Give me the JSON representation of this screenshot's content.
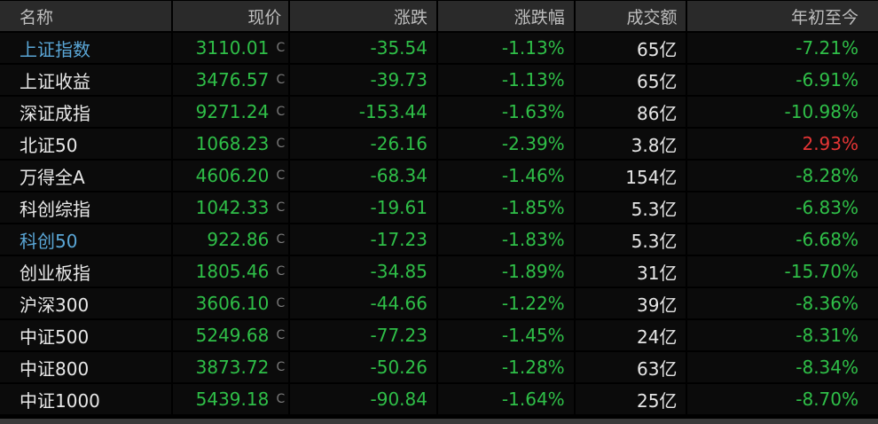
{
  "header": {
    "name": "名称",
    "price": "现价",
    "change": "涨跌",
    "change_pct": "涨跌幅",
    "volume": "成交额",
    "ytd": "年初至今"
  },
  "rows": [
    {
      "name": "上证指数",
      "link": true,
      "price": "3110.01",
      "mark": "C",
      "change": "-35.54",
      "change_pct": "-1.13%",
      "volume": "65亿",
      "ytd": "-7.21%",
      "ytd_dir": "neg"
    },
    {
      "name": "上证收益",
      "link": false,
      "price": "3476.57",
      "mark": "C",
      "change": "-39.73",
      "change_pct": "-1.13%",
      "volume": "65亿",
      "ytd": "-6.91%",
      "ytd_dir": "neg"
    },
    {
      "name": "深证成指",
      "link": false,
      "price": "9271.24",
      "mark": "C",
      "change": "-153.44",
      "change_pct": "-1.63%",
      "volume": "86亿",
      "ytd": "-10.98%",
      "ytd_dir": "neg"
    },
    {
      "name": "北证50",
      "link": false,
      "price": "1068.23",
      "mark": "C",
      "change": "-26.16",
      "change_pct": "-2.39%",
      "volume": "3.8亿",
      "ytd": "2.93%",
      "ytd_dir": "pos"
    },
    {
      "name": "万得全A",
      "link": false,
      "price": "4606.20",
      "mark": "C",
      "change": "-68.34",
      "change_pct": "-1.46%",
      "volume": "154亿",
      "ytd": "-8.28%",
      "ytd_dir": "neg"
    },
    {
      "name": "科创综指",
      "link": false,
      "price": "1042.33",
      "mark": "C",
      "change": "-19.61",
      "change_pct": "-1.85%",
      "volume": "5.3亿",
      "ytd": "-6.83%",
      "ytd_dir": "neg"
    },
    {
      "name": "科创50",
      "link": true,
      "price": "922.86",
      "mark": "C",
      "change": "-17.23",
      "change_pct": "-1.83%",
      "volume": "5.3亿",
      "ytd": "-6.68%",
      "ytd_dir": "neg"
    },
    {
      "name": "创业板指",
      "link": false,
      "price": "1805.46",
      "mark": "C",
      "change": "-34.85",
      "change_pct": "-1.89%",
      "volume": "31亿",
      "ytd": "-15.70%",
      "ytd_dir": "neg"
    },
    {
      "name": "沪深300",
      "link": false,
      "price": "3606.10",
      "mark": "C",
      "change": "-44.66",
      "change_pct": "-1.22%",
      "volume": "39亿",
      "ytd": "-8.36%",
      "ytd_dir": "neg"
    },
    {
      "name": "中证500",
      "link": false,
      "price": "5249.68",
      "mark": "C",
      "change": "-77.23",
      "change_pct": "-1.45%",
      "volume": "24亿",
      "ytd": "-8.31%",
      "ytd_dir": "neg"
    },
    {
      "name": "中证800",
      "link": false,
      "price": "3873.72",
      "mark": "C",
      "change": "-50.26",
      "change_pct": "-1.28%",
      "volume": "63亿",
      "ytd": "-8.34%",
      "ytd_dir": "neg"
    },
    {
      "name": "中证1000",
      "link": false,
      "price": "5439.18",
      "mark": "C",
      "change": "-90.84",
      "change_pct": "-1.64%",
      "volume": "25亿",
      "ytd": "-8.70%",
      "ytd_dir": "neg"
    }
  ],
  "colors": {
    "background": "#000000",
    "header_bg": "#2a2a2a",
    "down_green": "#2fbf48",
    "up_red": "#e53535",
    "link_blue": "#5aa6d6"
  }
}
